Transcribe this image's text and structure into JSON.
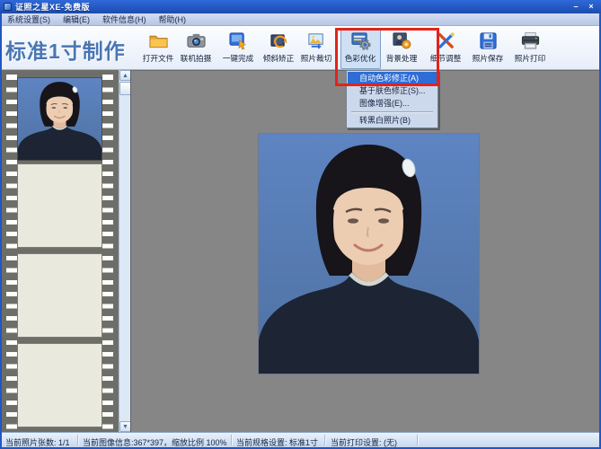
{
  "window": {
    "title": "证照之星XE-免费版",
    "minimize_glyph": "–",
    "close_glyph": "×"
  },
  "menubar": {
    "items": [
      {
        "label": "系统设置(S)"
      },
      {
        "label": "编辑(E)"
      },
      {
        "label": "软件信息(H)"
      },
      {
        "label": "帮助(H)"
      }
    ]
  },
  "toolbar": {
    "mode_title": "标准1寸制作",
    "buttons": [
      {
        "label": "打开文件",
        "icon": "folder-open-icon"
      },
      {
        "label": "联机拍摄",
        "icon": "camera-icon"
      },
      {
        "label": "一键完成",
        "icon": "one-click-finish-icon"
      },
      {
        "label": "倾斜矫正",
        "icon": "tilt-correction-icon"
      },
      {
        "label": "照片裁切",
        "icon": "photo-crop-icon"
      },
      {
        "label": "色彩优化",
        "icon": "color-optimize-icon",
        "highlighted": true
      },
      {
        "label": "背景处理",
        "icon": "background-process-icon",
        "highlighted": true
      },
      {
        "label": "细节调整",
        "icon": "detail-adjust-icon"
      },
      {
        "label": "照片保存",
        "icon": "photo-save-icon"
      },
      {
        "label": "照片打印",
        "icon": "photo-print-icon"
      }
    ]
  },
  "color_menu": {
    "items": [
      {
        "label": "自动色彩修正(A)",
        "selected": true
      },
      {
        "label": "基于肤色修正(S)..."
      },
      {
        "label": "图像增强(E)..."
      },
      {
        "label": "转黑白照片(B)"
      }
    ]
  },
  "annotation": {
    "highlight_color": "#e2231b"
  },
  "statusbar": {
    "photo_count": "当前照片张数: 1/1",
    "image_info": "当前图像信息:367*397，缩放比例 100%",
    "spec_setting": "当前规格设置: 标准1寸",
    "print_setting": "当前打印设置: (无)"
  },
  "colors": {
    "titlebar": "#2257c5",
    "workspace_bg": "#868686",
    "photo_background": "#5b80bc",
    "filmstrip": "#6e6e69",
    "menu_selection": "#2e6cd6"
  }
}
